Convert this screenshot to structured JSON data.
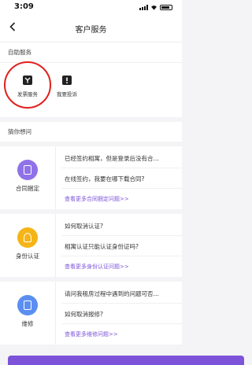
{
  "status_bar": {
    "time": "3:09"
  },
  "nav": {
    "back_icon": "chevron-left-icon",
    "title": "客户服务"
  },
  "self_service": {
    "heading": "自助服务",
    "items": [
      {
        "label": "发票服务",
        "icon": "invoice-icon"
      },
      {
        "label": "我要投诉",
        "icon": "complaint-icon"
      }
    ]
  },
  "guess": {
    "heading": "猜你想问"
  },
  "categories": [
    {
      "label": "合同捆定",
      "color": "#8f72e8",
      "icon": "contract-icon",
      "questions": [
        "已经签约相寓，但是登录后没有合…",
        "在线签约，我要在哪下载合同?"
      ],
      "more": "查看更多合同捆定问题>>"
    },
    {
      "label": "身份认证",
      "color": "#f5b417",
      "icon": "identity-icon",
      "questions": [
        "如何取消认证?",
        "相寓认证只能认证身份证吗?"
      ],
      "more": "查看更多身份认证问题>>"
    },
    {
      "label": "维修",
      "color": "#5b8ef0",
      "icon": "repair-icon",
      "questions": [
        "请问我租房过程中遇到的问题可否…",
        "如何取消报修?"
      ],
      "more": "查看更多维修问题>>"
    }
  ]
}
